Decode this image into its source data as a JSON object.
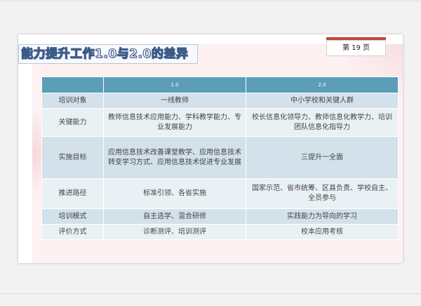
{
  "slide": {
    "title": "能力提升工作1.0与2.0的差异",
    "page_label": "第 19 页"
  },
  "table": {
    "headers": [
      "",
      "1.0",
      "2.0"
    ],
    "rows": [
      {
        "label": "培训对象",
        "v1": "一线教师",
        "v2": "中小学校和关键人群"
      },
      {
        "label": "关键能力",
        "v1": "教师信息技术应用能力、学科教学能力、专业发展能力",
        "v2": "校长信息化领导力、教师信息化教学力、培训团队信息化指导力"
      },
      {
        "label": "实施目标",
        "v1": "应用信息技术改善课堂教学、应用信息技术转变学习方式、应用信息技术促进专业发展",
        "v2": "三提升一全面"
      },
      {
        "label": "推进路径",
        "v1": "标准引领、各省实施",
        "v2": "国家示范、省市统筹、区县负责、学校自主、全员参与"
      },
      {
        "label": "培训模式",
        "v1": "自主选学、混合研修",
        "v2": "实践能力为导向的学习"
      },
      {
        "label": "评价方式",
        "v1": "诊断测评、培训测评",
        "v2": "校本应用考核"
      }
    ]
  },
  "colors": {
    "header": "#5c9db8",
    "row_dark": "#d2e1ea",
    "row_light": "#eaf1f5",
    "accent": "#c0463a",
    "title_stroke": "#3c5a88"
  }
}
